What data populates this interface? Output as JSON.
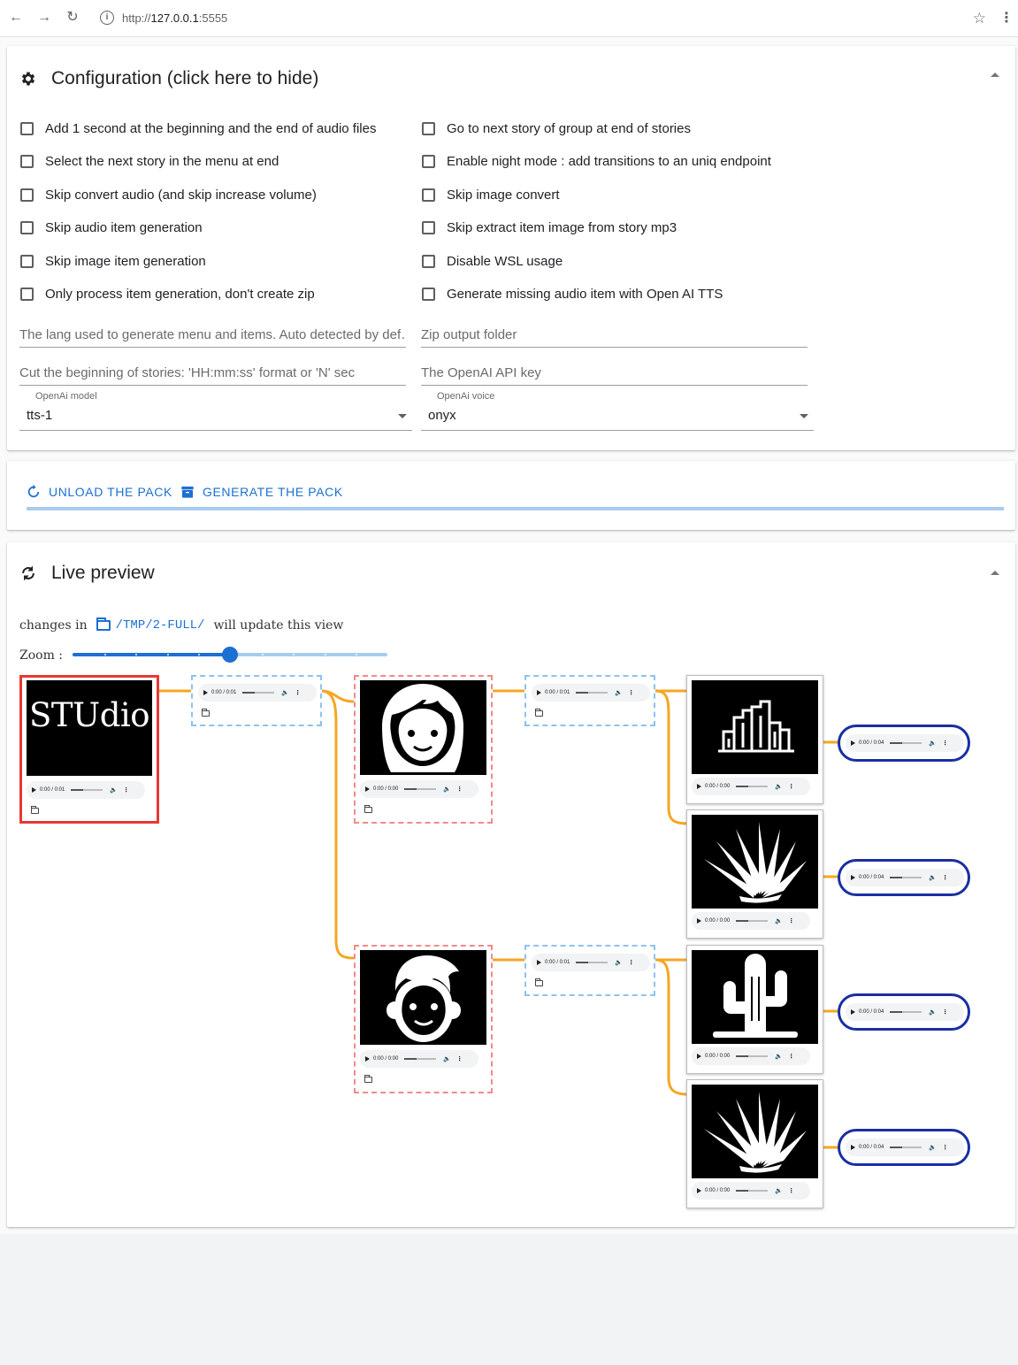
{
  "browser": {
    "url_scheme": "http://",
    "url_host": "127.0.0.1",
    "url_port": ":5555"
  },
  "config": {
    "title": "Configuration (click here to hide)",
    "icon": "gear-icon",
    "checkboxes_left": [
      "Add 1 second at the beginning and the end of audio files",
      "Select the next story in the menu at end",
      "Skip convert audio (and skip increase volume)",
      "Skip audio item generation",
      "Skip image item generation",
      "Only process item generation, don't create zip"
    ],
    "checkboxes_right": [
      "Go to next story of group at end of stories",
      "Enable night mode : add transitions to an uniq endpoint",
      "Skip image convert",
      "Skip extract item image from story mp3",
      "Disable WSL usage",
      "Generate missing audio item with Open AI TTS"
    ],
    "lang_placeholder": "The lang used to generate menu and items. Auto detected by def…",
    "zip_placeholder": "Zip output folder",
    "cut_placeholder": "Cut the beginning of stories: 'HH:mm:ss' format or 'N' sec",
    "apikey_placeholder": "The OpenAI API key",
    "model_label": "OpenAi model",
    "model_value": "tts-1",
    "voice_label": "OpenAi voice",
    "voice_value": "onyx"
  },
  "actions": {
    "unload_label": "UNLOAD THE PACK",
    "generate_label": "GENERATE THE PACK",
    "accent": "#1e6fd2"
  },
  "preview": {
    "title": "Live preview",
    "changes_prefix": "changes in",
    "changes_path": "/TMP/2-FULL/",
    "changes_suffix": "will update this view",
    "zoom_label": "Zoom :",
    "zoom_fraction": 0.5,
    "zoom_steps": 10
  },
  "graph": {
    "edge_color": "#f5a623",
    "studio_text": "STUdio",
    "audio_short": "0:00 / 0:01",
    "audio_zero": "0:00 / 0:00",
    "audio_end": "0:00 / 0:04",
    "images": [
      "studio-logo",
      "girl-face-icon",
      "buildings-icon",
      "agave-plant-icon",
      "boy-face-icon",
      "cactus-icon",
      "agave-plant-icon"
    ]
  }
}
